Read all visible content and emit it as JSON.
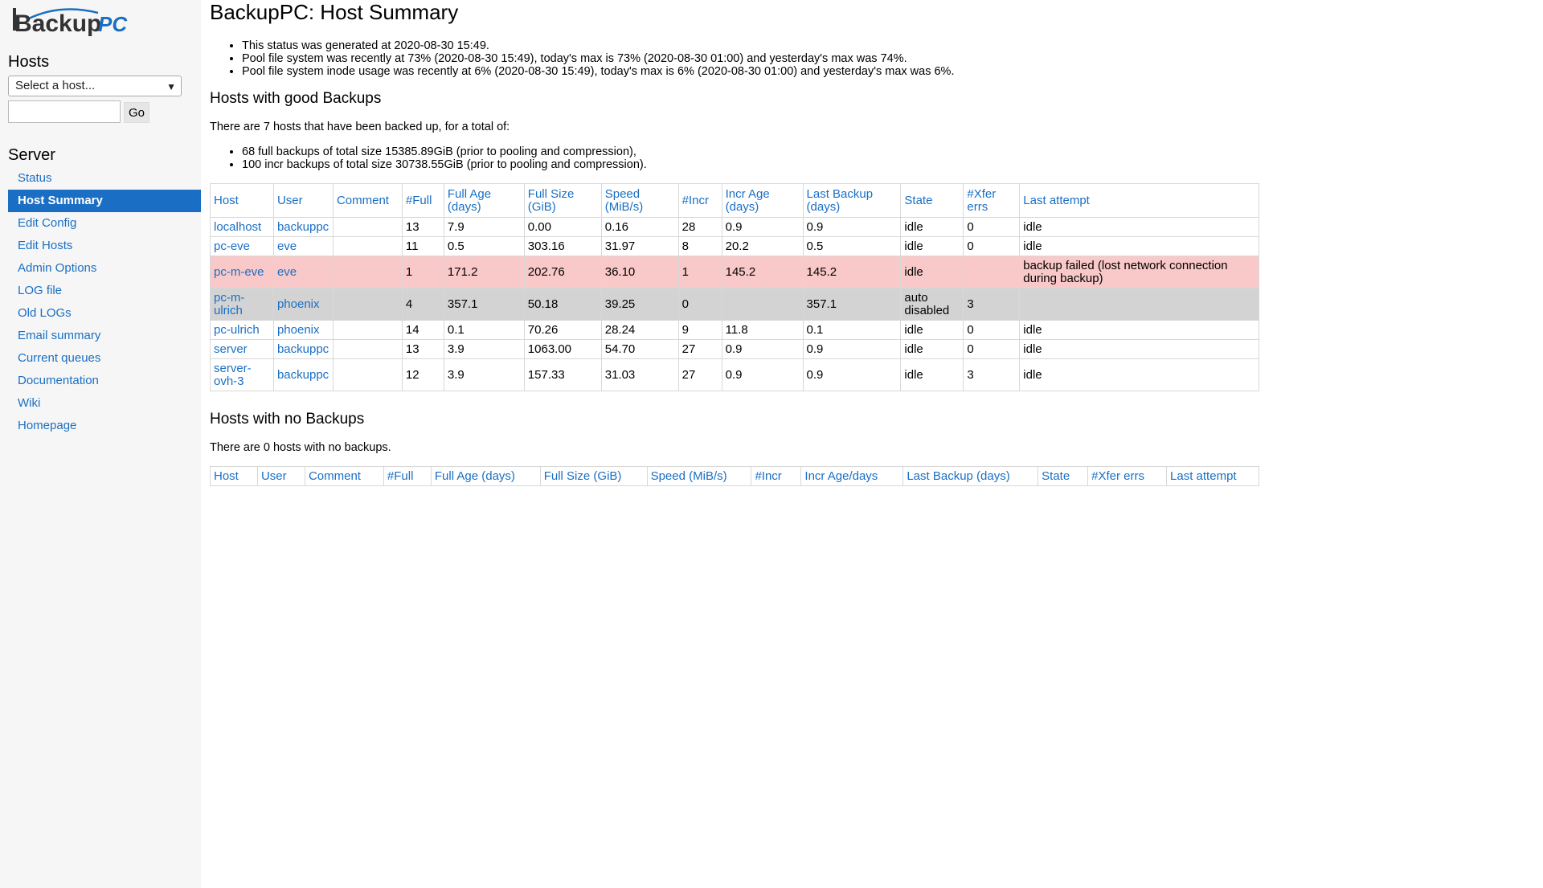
{
  "sidebar": {
    "logo_text": "BackupPC",
    "hosts_heading": "Hosts",
    "host_select": "Select a host...",
    "search_value": "",
    "go_label": "Go",
    "server_heading": "Server",
    "nav": [
      {
        "label": "Status"
      },
      {
        "label": "Host Summary",
        "active": true
      },
      {
        "label": "Edit Config"
      },
      {
        "label": "Edit Hosts"
      },
      {
        "label": "Admin Options"
      },
      {
        "label": "LOG file"
      },
      {
        "label": "Old LOGs"
      },
      {
        "label": "Email summary"
      },
      {
        "label": "Current queues"
      },
      {
        "label": "Documentation"
      },
      {
        "label": "Wiki"
      },
      {
        "label": "Homepage"
      }
    ]
  },
  "main": {
    "title": "BackupPC: Host Summary",
    "status_lines": [
      "This status was generated at 2020-08-30 15:49.",
      "Pool file system was recently at 73% (2020-08-30 15:49), today's max is 73% (2020-08-30 01:00) and yesterday's max was 74%.",
      "Pool file system inode usage was recently at 6% (2020-08-30 15:49), today's max is 6% (2020-08-30 01:00) and yesterday's max was 6%."
    ],
    "good": {
      "heading": "Hosts with good Backups",
      "intro": "There are 7 hosts that have been backed up, for a total of:",
      "totals": [
        "68 full backups of total size 15385.89GiB (prior to pooling and compression),",
        "100 incr backups of total size 30738.55GiB (prior to pooling and compression)."
      ],
      "headers": [
        "Host",
        "User",
        "Comment",
        "#Full",
        "Full Age (days)",
        "Full Size (GiB)",
        "Speed (MiB/s)",
        "#Incr",
        "Incr Age (days)",
        "Last Backup (days)",
        "State",
        "#Xfer errs",
        "Last attempt"
      ],
      "rows": [
        {
          "cells": [
            "localhost",
            "backuppc",
            "",
            "13",
            "7.9",
            "0.00",
            "0.16",
            "28",
            "0.9",
            "0.9",
            "idle",
            "0",
            "idle"
          ],
          "status": "normal"
        },
        {
          "cells": [
            "pc-eve",
            "eve",
            "",
            "11",
            "0.5",
            "303.16",
            "31.97",
            "8",
            "20.2",
            "0.5",
            "idle",
            "0",
            "idle"
          ],
          "status": "normal"
        },
        {
          "cells": [
            "pc-m-eve",
            "eve",
            "",
            "1",
            "171.2",
            "202.76",
            "36.10",
            "1",
            "145.2",
            "145.2",
            "idle",
            "",
            "backup failed (lost network connection during backup)"
          ],
          "status": "failed"
        },
        {
          "cells": [
            "pc-m-ulrich",
            "phoenix",
            "",
            "4",
            "357.1",
            "50.18",
            "39.25",
            "0",
            "",
            "357.1",
            "auto disabled",
            "3",
            ""
          ],
          "status": "disabled"
        },
        {
          "cells": [
            "pc-ulrich",
            "phoenix",
            "",
            "14",
            "0.1",
            "70.26",
            "28.24",
            "9",
            "11.8",
            "0.1",
            "idle",
            "0",
            "idle"
          ],
          "status": "normal"
        },
        {
          "cells": [
            "server",
            "backuppc",
            "",
            "13",
            "3.9",
            "1063.00",
            "54.70",
            "27",
            "0.9",
            "0.9",
            "idle",
            "0",
            "idle"
          ],
          "status": "normal"
        },
        {
          "cells": [
            "server-ovh-3",
            "backuppc",
            "",
            "12",
            "3.9",
            "157.33",
            "31.03",
            "27",
            "0.9",
            "0.9",
            "idle",
            "3",
            "idle"
          ],
          "status": "normal"
        }
      ]
    },
    "none": {
      "heading": "Hosts with no Backups",
      "intro": "There are 0 hosts with no backups.",
      "headers": [
        "Host",
        "User",
        "Comment",
        "#Full",
        "Full Age (days)",
        "Full Size (GiB)",
        "Speed (MiB/s)",
        "#Incr",
        "Incr Age/days",
        "Last Backup (days)",
        "State",
        "#Xfer errs",
        "Last attempt"
      ]
    }
  }
}
